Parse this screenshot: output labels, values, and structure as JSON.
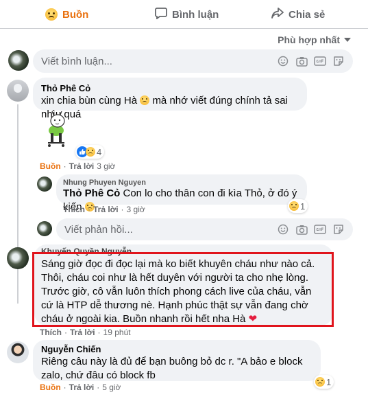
{
  "actions": {
    "react_label": "Buồn",
    "comment_label": "Bình luận",
    "share_label": "Chia sẻ"
  },
  "sort_label": "Phù hợp nhất",
  "comment_input": {
    "placeholder": "Viết bình luận..."
  },
  "reply_input": {
    "placeholder": "Viết phản hồi..."
  },
  "comments": [
    {
      "author": "Thỏ Phê Cỏ",
      "text": "xin chia bùn cùng Hà",
      "text_tail": "mà nhớ viết đúng chính tả sai nhìu quá",
      "reaction_count": "4",
      "react_label": "Buồn",
      "reply_label": "Trả lời",
      "time": "3 giờ"
    },
    {
      "author": "Nhung Phuyen Nguyen",
      "mention": "Thỏ Phê Cỏ",
      "text": "Con lo cho thân con đi kìa Thỏ, ở đó ý kiến",
      "reaction_count": "1",
      "like_label": "Thích",
      "reply_label": "Trả lời",
      "time": "3 giờ"
    },
    {
      "author": "Khuyến Quyền Nguyễn",
      "text": "Sáng giờ đọc đi đọc lại mà ko biết khuyên cháu như nào cả. Thôi, cháu coi như là hết duyên với người ta cho nhẹ lòng. Trước giờ, cô vẫn luôn thích phong cách live của cháu, vẫn cứ là HTP dễ thương nè. Hạnh phúc thật sự vẫn đang chờ cháu ở ngoài kia. Buồn nhanh rồi hết nha Hà",
      "like_label": "Thích",
      "reply_label": "Trả lời",
      "time": "19 phút"
    },
    {
      "author": "Nguyễn Chiến",
      "text": "Riêng câu này là đủ để bạn buông bỏ dc r. \"A bảo e block zalo, chứ đâu có block fb",
      "reaction_count": "1",
      "react_label": "Buồn",
      "reply_label": "Trả lời",
      "time": "5 giờ"
    }
  ],
  "icons": [
    "sad-emoji",
    "comment-icon",
    "share-icon",
    "emoji-icon",
    "camera-icon",
    "gif-icon",
    "sticker-icon",
    "like-icon",
    "heart-icon"
  ],
  "colors": {
    "sad_orange": "#e9710f",
    "highlight_red": "#e0141c",
    "like_blue": "#1877f2",
    "heart_red": "#e41e3f"
  }
}
